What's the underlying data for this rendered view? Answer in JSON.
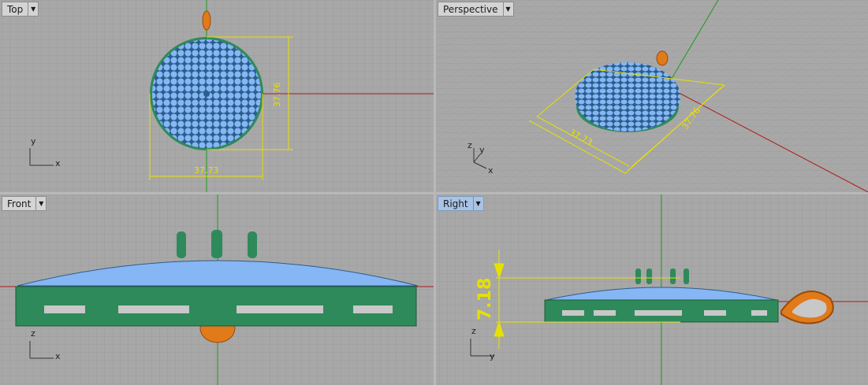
{
  "viewports": {
    "top": {
      "title": "Top",
      "dim_h": "37.73",
      "dim_v": "37.76",
      "axis_v": "y",
      "axis_h": "x"
    },
    "perspective": {
      "title": "Perspective",
      "dim_a": "37.73",
      "dim_b": "37.76",
      "axis_z": "z",
      "axis_y": "y",
      "axis_x": "x"
    },
    "front": {
      "title": "Front",
      "axis_v": "z",
      "axis_h": "x"
    },
    "right": {
      "title": "Right",
      "dim_v": "7.18",
      "axis_v": "z",
      "axis_h": "y"
    }
  },
  "active_viewport": "Right",
  "dropdown_glyph": "▼",
  "colors": {
    "viewport_bg": "#a8a8a8",
    "grid_minor": "#9c9c9c",
    "grid_major": "#8e8e8e",
    "x_axis": "#b01818",
    "z_axis": "#1c9a1c",
    "mesh_blue": "#86b6f4",
    "frame_green": "#2e8a5a",
    "bail_orange": "#e07a1a",
    "dimension_yellow": "#e7e000"
  }
}
